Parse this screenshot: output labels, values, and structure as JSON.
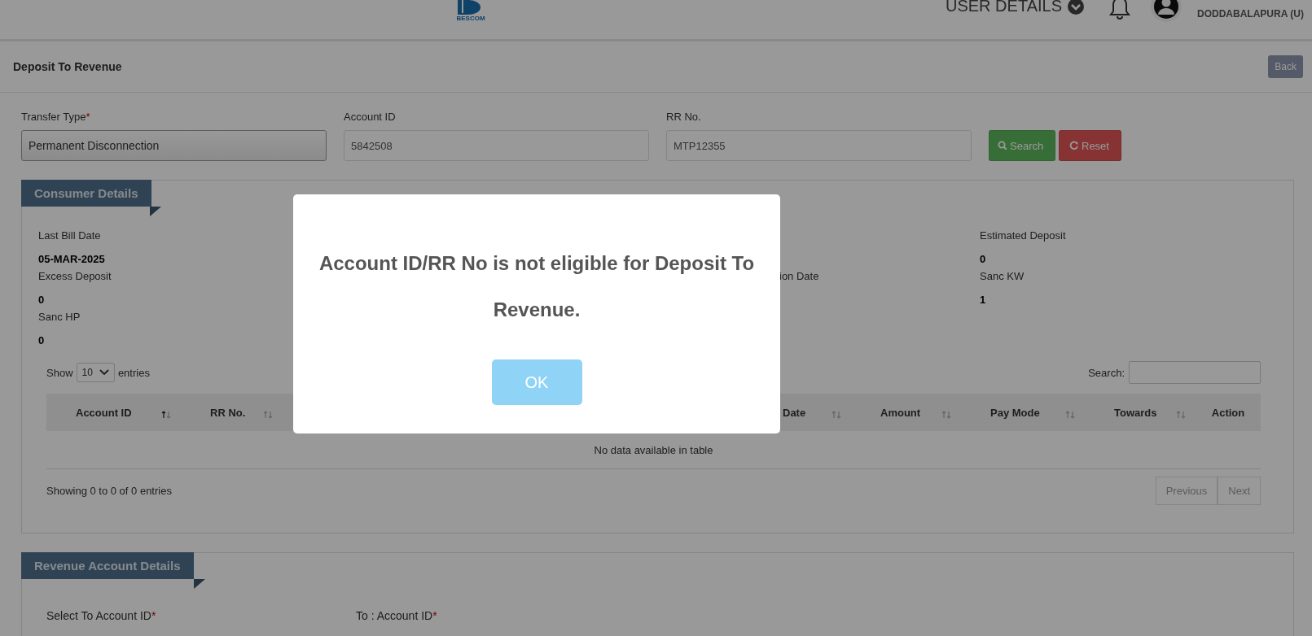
{
  "header": {
    "logo_text": "BESCOM",
    "user_menu": "USER DETAILS",
    "location": "DODDABALAPURA (U)"
  },
  "page": {
    "title": "Deposit To Revenue",
    "back_button": "Back"
  },
  "form": {
    "fields": [
      {
        "label": "Transfer Type",
        "required_mark": "*",
        "kind": "select",
        "value": "Permanent Disconnection"
      },
      {
        "label": "Account ID",
        "kind": "input",
        "value": "5842508"
      },
      {
        "label": "RR No.",
        "kind": "input",
        "value": "MTP12355"
      }
    ],
    "buttons": [
      {
        "label": "Search",
        "kind": "search"
      },
      {
        "label": "Reset",
        "kind": "reset"
      }
    ]
  },
  "consumer_details": {
    "title": "Consumer Details",
    "fields": [
      {
        "kind": "field",
        "label": "Last Bill Date",
        "value": "05-MAR-2025"
      },
      {
        "kind": "covered"
      },
      {
        "kind": "covered"
      },
      {
        "kind": "field",
        "label": "Estimated Deposit",
        "value": "0"
      },
      {
        "kind": "field",
        "label": "Excess Deposit",
        "value": "0"
      },
      {
        "kind": "covered"
      },
      {
        "kind": "field",
        "label": "ion Date"
      },
      {
        "kind": "field",
        "label": "Sanc KW",
        "value": "1"
      },
      {
        "kind": "field",
        "label": "Sanc HP",
        "value": "0"
      }
    ],
    "table": {
      "length_label_before": "Show",
      "length_value": "10",
      "length_label_after": "entries",
      "search_label": "Search:",
      "columns": [
        {
          "kind": "column",
          "label": "Account ID",
          "sorted": true
        },
        {
          "kind": "column",
          "label": "RR No.",
          "sorted": false
        },
        {
          "kind": "covered"
        },
        {
          "kind": "covered"
        },
        {
          "kind": "covered"
        },
        {
          "kind": "covered"
        },
        {
          "kind": "column",
          "label": "Date",
          "sorted": false
        },
        {
          "kind": "column",
          "label": "Amount",
          "sorted": false
        },
        {
          "kind": "column",
          "label": "Pay Mode",
          "sorted": false
        },
        {
          "kind": "column",
          "label": "Towards",
          "sorted": false
        },
        {
          "kind": "column",
          "label": "Action"
        }
      ],
      "empty_text": "No data available in table",
      "info": "Showing 0 to 0 of 0 entries",
      "pagination": [
        {
          "label": "Previous",
          "disabled": true
        },
        {
          "label": "Next",
          "disabled": true
        }
      ]
    }
  },
  "revenue_account_details": {
    "title": "Revenue Account Details",
    "fields": [
      {
        "label": "Select To Account ID",
        "required_mark": "*"
      },
      {
        "label": "To : Account ID",
        "required_mark": "*"
      }
    ]
  },
  "modal": {
    "message": "Account ID/RR No is not eligible for Deposit To Revenue.",
    "button": "OK"
  }
}
